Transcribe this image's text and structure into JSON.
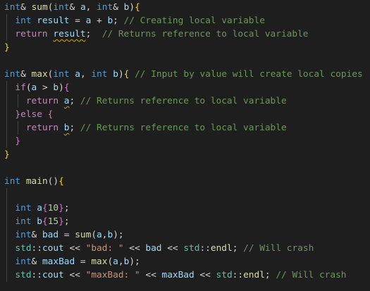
{
  "editor": {
    "theme": {
      "background": "#1e1e1e",
      "keyword": "#569cd6",
      "control": "#c586c0",
      "function": "#dcdcaa",
      "variable": "#9cdcfe",
      "number": "#b5cea8",
      "string": "#ce9178",
      "comment": "#6a9955",
      "namespace": "#4ec9b0",
      "brace": "#ffd700",
      "brace_nested": "#da70d6",
      "warning": "#cca700"
    },
    "lines": [
      {
        "guides": 0,
        "tokens": [
          {
            "t": "int",
            "c": "keyword"
          },
          {
            "t": "&",
            "c": "plain"
          },
          {
            "t": " ",
            "c": "plain"
          },
          {
            "t": "sum",
            "c": "function"
          },
          {
            "t": "(",
            "c": "plain"
          },
          {
            "t": "int",
            "c": "keyword"
          },
          {
            "t": "& ",
            "c": "plain"
          },
          {
            "t": "a",
            "c": "variable"
          },
          {
            "t": ", ",
            "c": "plain"
          },
          {
            "t": "int",
            "c": "keyword"
          },
          {
            "t": "& ",
            "c": "plain"
          },
          {
            "t": "b",
            "c": "variable"
          },
          {
            "t": ")",
            "c": "plain"
          },
          {
            "t": "{",
            "c": "brace"
          }
        ]
      },
      {
        "guides": 1,
        "tokens": [
          {
            "t": "  int",
            "c": "keyword"
          },
          {
            "t": " ",
            "c": "plain"
          },
          {
            "t": "result",
            "c": "variable"
          },
          {
            "t": " = ",
            "c": "plain"
          },
          {
            "t": "a",
            "c": "variable"
          },
          {
            "t": " + ",
            "c": "plain"
          },
          {
            "t": "b",
            "c": "variable"
          },
          {
            "t": "; ",
            "c": "plain"
          },
          {
            "t": "// Creating local variable",
            "c": "comment"
          }
        ]
      },
      {
        "guides": 1,
        "tokens": [
          {
            "t": "  return",
            "c": "control"
          },
          {
            "t": " ",
            "c": "plain"
          },
          {
            "t": "result",
            "c": "variable",
            "warn": true
          },
          {
            "t": ";  ",
            "c": "plain"
          },
          {
            "t": "// Returns reference to local variable",
            "c": "comment"
          }
        ]
      },
      {
        "guides": 0,
        "tokens": [
          {
            "t": "}",
            "c": "brace"
          }
        ]
      },
      {
        "guides": 0,
        "tokens": []
      },
      {
        "guides": 0,
        "tokens": [
          {
            "t": "int",
            "c": "keyword"
          },
          {
            "t": "& ",
            "c": "plain"
          },
          {
            "t": "max",
            "c": "function"
          },
          {
            "t": "(",
            "c": "plain"
          },
          {
            "t": "int",
            "c": "keyword"
          },
          {
            "t": " ",
            "c": "plain"
          },
          {
            "t": "a",
            "c": "variable"
          },
          {
            "t": ", ",
            "c": "plain"
          },
          {
            "t": "int",
            "c": "keyword"
          },
          {
            "t": " ",
            "c": "plain"
          },
          {
            "t": "b",
            "c": "variable"
          },
          {
            "t": ")",
            "c": "plain"
          },
          {
            "t": "{",
            "c": "brace"
          },
          {
            "t": " ",
            "c": "plain"
          },
          {
            "t": "// Input by value will create local copies",
            "c": "comment"
          }
        ]
      },
      {
        "guides": 1,
        "tokens": [
          {
            "t": "  if",
            "c": "control"
          },
          {
            "t": "(",
            "c": "plain"
          },
          {
            "t": "a",
            "c": "variable"
          },
          {
            "t": " > ",
            "c": "plain"
          },
          {
            "t": "b",
            "c": "variable"
          },
          {
            "t": ")",
            "c": "plain"
          },
          {
            "t": "{",
            "c": "brace2"
          }
        ]
      },
      {
        "guides": 2,
        "tokens": [
          {
            "t": "    return",
            "c": "control"
          },
          {
            "t": " ",
            "c": "plain"
          },
          {
            "t": "a",
            "c": "variable",
            "warn": true
          },
          {
            "t": "; ",
            "c": "plain"
          },
          {
            "t": "// Returns reference to local variable",
            "c": "comment"
          }
        ]
      },
      {
        "guides": 1,
        "tokens": [
          {
            "t": "  }",
            "c": "brace2"
          },
          {
            "t": "else",
            "c": "control"
          },
          {
            "t": " ",
            "c": "plain"
          },
          {
            "t": "{",
            "c": "brace2"
          }
        ]
      },
      {
        "guides": 2,
        "tokens": [
          {
            "t": "    return",
            "c": "control"
          },
          {
            "t": " ",
            "c": "plain"
          },
          {
            "t": "b",
            "c": "variable",
            "warn": true
          },
          {
            "t": "; ",
            "c": "plain"
          },
          {
            "t": "// Returns reference to local variable",
            "c": "comment"
          }
        ]
      },
      {
        "guides": 1,
        "tokens": [
          {
            "t": "  }",
            "c": "brace2"
          }
        ]
      },
      {
        "guides": 0,
        "tokens": [
          {
            "t": "}",
            "c": "brace"
          }
        ]
      },
      {
        "guides": 0,
        "tokens": []
      },
      {
        "guides": 0,
        "tokens": [
          {
            "t": "int",
            "c": "keyword"
          },
          {
            "t": " ",
            "c": "plain"
          },
          {
            "t": "main",
            "c": "function"
          },
          {
            "t": "()",
            "c": "plain"
          },
          {
            "t": "{",
            "c": "brace"
          }
        ]
      },
      {
        "guides": 1,
        "tokens": []
      },
      {
        "guides": 1,
        "tokens": [
          {
            "t": "  int",
            "c": "keyword"
          },
          {
            "t": " ",
            "c": "plain"
          },
          {
            "t": "a",
            "c": "variable"
          },
          {
            "t": "{",
            "c": "brace2"
          },
          {
            "t": "10",
            "c": "number"
          },
          {
            "t": "}",
            "c": "brace2"
          },
          {
            "t": ";",
            "c": "plain"
          }
        ]
      },
      {
        "guides": 1,
        "tokens": [
          {
            "t": "  int",
            "c": "keyword"
          },
          {
            "t": " ",
            "c": "plain"
          },
          {
            "t": "b",
            "c": "variable"
          },
          {
            "t": "{",
            "c": "brace2"
          },
          {
            "t": "15",
            "c": "number"
          },
          {
            "t": "}",
            "c": "brace2"
          },
          {
            "t": ";",
            "c": "plain"
          }
        ]
      },
      {
        "guides": 1,
        "tokens": [
          {
            "t": "  int",
            "c": "keyword"
          },
          {
            "t": "& ",
            "c": "plain"
          },
          {
            "t": "bad",
            "c": "variable"
          },
          {
            "t": " = ",
            "c": "plain"
          },
          {
            "t": "sum",
            "c": "function"
          },
          {
            "t": "(",
            "c": "plain"
          },
          {
            "t": "a",
            "c": "variable"
          },
          {
            "t": ",",
            "c": "plain"
          },
          {
            "t": "b",
            "c": "variable"
          },
          {
            "t": ");",
            "c": "plain"
          }
        ]
      },
      {
        "guides": 1,
        "tokens": [
          {
            "t": "  std",
            "c": "namespace"
          },
          {
            "t": "::",
            "c": "plain"
          },
          {
            "t": "cout",
            "c": "variable"
          },
          {
            "t": " << ",
            "c": "plain"
          },
          {
            "t": "\"bad: \"",
            "c": "string"
          },
          {
            "t": " << ",
            "c": "plain"
          },
          {
            "t": "bad",
            "c": "variable"
          },
          {
            "t": " << ",
            "c": "plain"
          },
          {
            "t": "std",
            "c": "namespace"
          },
          {
            "t": "::",
            "c": "plain"
          },
          {
            "t": "endl",
            "c": "function"
          },
          {
            "t": "; ",
            "c": "plain"
          },
          {
            "t": "// Will crash",
            "c": "comment"
          }
        ]
      },
      {
        "guides": 1,
        "tokens": [
          {
            "t": "  int",
            "c": "keyword"
          },
          {
            "t": "& ",
            "c": "plain"
          },
          {
            "t": "maxBad",
            "c": "variable"
          },
          {
            "t": " = ",
            "c": "plain"
          },
          {
            "t": "max",
            "c": "function"
          },
          {
            "t": "(",
            "c": "plain"
          },
          {
            "t": "a",
            "c": "variable"
          },
          {
            "t": ",",
            "c": "plain"
          },
          {
            "t": "b",
            "c": "variable"
          },
          {
            "t": ");",
            "c": "plain"
          }
        ]
      },
      {
        "guides": 1,
        "tokens": [
          {
            "t": "  std",
            "c": "namespace"
          },
          {
            "t": "::",
            "c": "plain"
          },
          {
            "t": "cout",
            "c": "variable"
          },
          {
            "t": " << ",
            "c": "plain"
          },
          {
            "t": "\"maxBad: \"",
            "c": "string"
          },
          {
            "t": " << ",
            "c": "plain"
          },
          {
            "t": "maxBad",
            "c": "variable"
          },
          {
            "t": " << ",
            "c": "plain"
          },
          {
            "t": "std",
            "c": "namespace"
          },
          {
            "t": "::",
            "c": "plain"
          },
          {
            "t": "endl",
            "c": "function"
          },
          {
            "t": "; ",
            "c": "plain"
          },
          {
            "t": "// Will crash",
            "c": "comment"
          }
        ]
      }
    ]
  }
}
